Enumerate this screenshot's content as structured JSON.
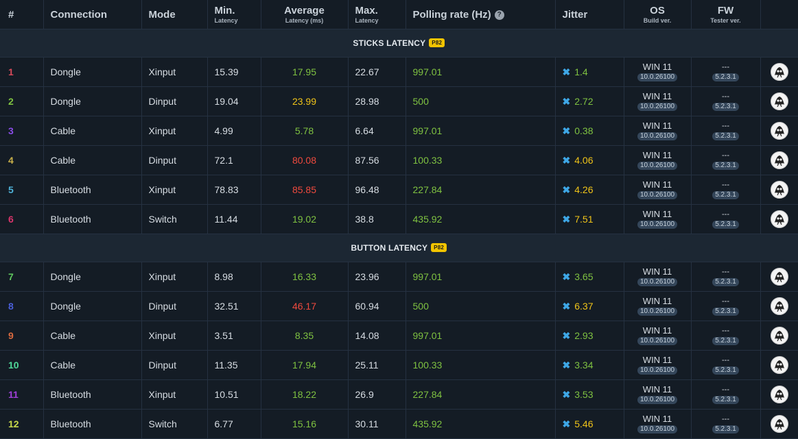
{
  "columns": {
    "num": "#",
    "connection": "Connection",
    "mode": "Mode",
    "min": "Min.",
    "min_sub": "Latency",
    "avg": "Average",
    "avg_sub": "Latency (ms)",
    "max": "Max.",
    "max_sub": "Latency",
    "polling": "Polling rate (Hz)",
    "jitter": "Jitter",
    "os": "OS",
    "os_sub": "Build ver.",
    "fw": "FW",
    "fw_sub": "Tester ver."
  },
  "colors": {
    "green": "#7fc241",
    "yellow": "#f0c419",
    "red": "#f04a3e",
    "accent_blue": "#3ea7e6",
    "badge": "#f2c400"
  },
  "sections": [
    {
      "title": "STICKS LATENCY",
      "badge": "P82",
      "rows": [
        {
          "num": "1",
          "num_color": "#d94b5b",
          "connection": "Dongle",
          "mode": "Xinput",
          "min": "15.39",
          "avg": "17.95",
          "avg_color": "green",
          "max": "22.67",
          "polling": "997.01",
          "jitter": "1.4",
          "jitter_color": "green",
          "os": "WIN 11",
          "os_build": "10.0.26100",
          "fw": "---",
          "fw_ver": "5.2.3.1"
        },
        {
          "num": "2",
          "num_color": "#7fc241",
          "connection": "Dongle",
          "mode": "Dinput",
          "min": "19.04",
          "avg": "23.99",
          "avg_color": "yellow",
          "max": "28.98",
          "polling": "500",
          "jitter": "2.72",
          "jitter_color": "green",
          "os": "WIN 11",
          "os_build": "10.0.26100",
          "fw": "---",
          "fw_ver": "5.2.3.1"
        },
        {
          "num": "3",
          "num_color": "#8a4de8",
          "connection": "Cable",
          "mode": "Xinput",
          "min": "4.99",
          "avg": "5.78",
          "avg_color": "green",
          "max": "6.64",
          "polling": "997.01",
          "jitter": "0.38",
          "jitter_color": "green",
          "os": "WIN 11",
          "os_build": "10.0.26100",
          "fw": "---",
          "fw_ver": "5.2.3.1"
        },
        {
          "num": "4",
          "num_color": "#c9b04a",
          "connection": "Cable",
          "mode": "Dinput",
          "min": "72.1",
          "avg": "80.08",
          "avg_color": "red",
          "max": "87.56",
          "polling": "100.33",
          "jitter": "4.06",
          "jitter_color": "yellow",
          "os": "WIN 11",
          "os_build": "10.0.26100",
          "fw": "---",
          "fw_ver": "5.2.3.1"
        },
        {
          "num": "5",
          "num_color": "#4fb3d9",
          "connection": "Bluetooth",
          "mode": "Xinput",
          "min": "78.83",
          "avg": "85.85",
          "avg_color": "red",
          "max": "96.48",
          "polling": "227.84",
          "jitter": "4.26",
          "jitter_color": "yellow",
          "os": "WIN 11",
          "os_build": "10.0.26100",
          "fw": "---",
          "fw_ver": "5.2.3.1"
        },
        {
          "num": "6",
          "num_color": "#d9356b",
          "connection": "Bluetooth",
          "mode": "Switch",
          "min": "11.44",
          "avg": "19.02",
          "avg_color": "green",
          "max": "38.8",
          "polling": "435.92",
          "jitter": "7.51",
          "jitter_color": "yellow",
          "os": "WIN 11",
          "os_build": "10.0.26100",
          "fw": "---",
          "fw_ver": "5.2.3.1"
        }
      ]
    },
    {
      "title": "BUTTON LATENCY",
      "badge": "P82",
      "rows": [
        {
          "num": "7",
          "num_color": "#5fc95f",
          "connection": "Dongle",
          "mode": "Xinput",
          "min": "8.98",
          "avg": "16.33",
          "avg_color": "green",
          "max": "23.96",
          "polling": "997.01",
          "jitter": "3.65",
          "jitter_color": "green",
          "os": "WIN 11",
          "os_build": "10.0.26100",
          "fw": "---",
          "fw_ver": "5.2.3.1"
        },
        {
          "num": "8",
          "num_color": "#4a5fd9",
          "connection": "Dongle",
          "mode": "Dinput",
          "min": "32.51",
          "avg": "46.17",
          "avg_color": "red",
          "max": "60.94",
          "polling": "500",
          "jitter": "6.37",
          "jitter_color": "yellow",
          "os": "WIN 11",
          "os_build": "10.0.26100",
          "fw": "---",
          "fw_ver": "5.2.3.1"
        },
        {
          "num": "9",
          "num_color": "#d96a3f",
          "connection": "Cable",
          "mode": "Xinput",
          "min": "3.51",
          "avg": "8.35",
          "avg_color": "green",
          "max": "14.08",
          "polling": "997.01",
          "jitter": "2.93",
          "jitter_color": "green",
          "os": "WIN 11",
          "os_build": "10.0.26100",
          "fw": "---",
          "fw_ver": "5.2.3.1"
        },
        {
          "num": "10",
          "num_color": "#4fd99a",
          "connection": "Cable",
          "mode": "Dinput",
          "min": "11.35",
          "avg": "17.94",
          "avg_color": "green",
          "max": "25.11",
          "polling": "100.33",
          "jitter": "3.34",
          "jitter_color": "green",
          "os": "WIN 11",
          "os_build": "10.0.26100",
          "fw": "---",
          "fw_ver": "5.2.3.1"
        },
        {
          "num": "11",
          "num_color": "#a03fd9",
          "connection": "Bluetooth",
          "mode": "Xinput",
          "min": "10.51",
          "avg": "18.22",
          "avg_color": "green",
          "max": "26.9",
          "polling": "227.84",
          "jitter": "3.53",
          "jitter_color": "green",
          "os": "WIN 11",
          "os_build": "10.0.26100",
          "fw": "---",
          "fw_ver": "5.2.3.1"
        },
        {
          "num": "12",
          "num_color": "#c9d94a",
          "connection": "Bluetooth",
          "mode": "Switch",
          "min": "6.77",
          "avg": "15.16",
          "avg_color": "green",
          "max": "30.11",
          "polling": "435.92",
          "jitter": "5.46",
          "jitter_color": "yellow",
          "os": "WIN 11",
          "os_build": "10.0.26100",
          "fw": "---",
          "fw_ver": "5.2.3.1"
        }
      ]
    }
  ],
  "icons": {
    "help": "question-circle-icon",
    "jitter_mark": "x-mark-icon",
    "avatar": "tester-avatar-icon"
  }
}
